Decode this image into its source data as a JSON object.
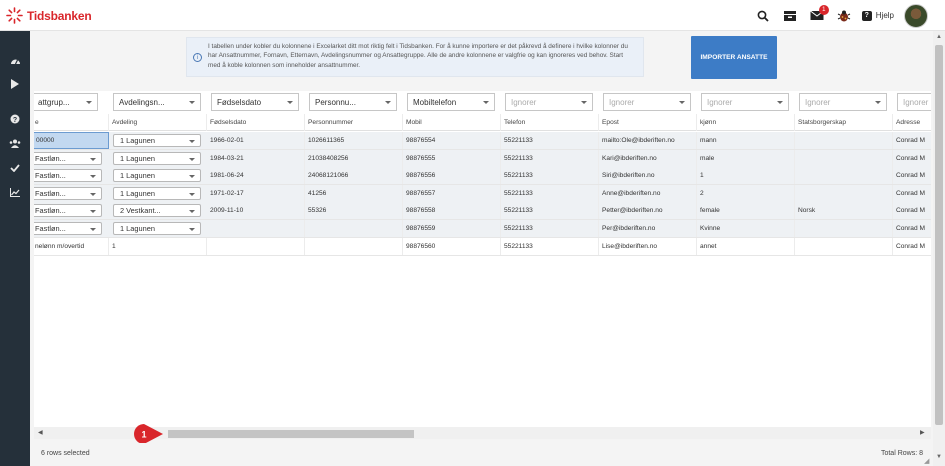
{
  "app": {
    "brand": "Tidsbanken"
  },
  "topbar": {
    "notification_count": "1",
    "help_label": "Hjelp"
  },
  "info": {
    "text": "I tabellen under kobler du kolonnene i Excelarket ditt mot riktig felt i Tidsbanken. For å kunne importere er det påkrevd å definere i hvilke kolonner du har Ansattnummer, Fornavn, Etternavn, Avdelingsnummer og Ansattegruppe. Alle de andre kolonnene er valgfrie og kan ignoreres ved behov. Start med å koble kolonnen som inneholder ansattnummer."
  },
  "import_button": "IMPORTER ANSATTE",
  "mapping_selects": [
    "attgrup...",
    "Avdelingsn...",
    "Fødselsdato",
    "Personnu...",
    "Mobiltelefon",
    "Ignorer",
    "Ignorer",
    "Ignorer",
    "Ignorer",
    "Ignorer",
    "Ignorer"
  ],
  "headers": [
    "e",
    "Avdeling",
    "Fødselsdato",
    "Personnummer",
    "Mobil",
    "Telefon",
    "Epost",
    "kjønn",
    "Statsborgerskap",
    "Adresse"
  ],
  "rows": [
    {
      "c0": "00000",
      "c1": "1 Lagunen",
      "c2": "1966-02-01",
      "c3": "1026611365",
      "c4": "98876554",
      "c5": "55221133",
      "c6": "mailto:Ole@ibderiften.no",
      "c7": "mann",
      "c8": "",
      "c9": "Conrad M"
    },
    {
      "c0": "Fastløn...",
      "c1": "1 Lagunen",
      "c2": "1984-03-21",
      "c3": "21038408256",
      "c4": "98876555",
      "c5": "55221133",
      "c6": "Kari@ibderiften.no",
      "c7": "male",
      "c8": "",
      "c9": "Conrad M"
    },
    {
      "c0": "Fastløn...",
      "c1": "1 Lagunen",
      "c2": "1981-06-24",
      "c3": "24068121066",
      "c4": "98876556",
      "c5": "55221133",
      "c6": "Siri@ibderiften.no",
      "c7": "1",
      "c8": "",
      "c9": "Conrad M"
    },
    {
      "c0": "Fastløn...",
      "c1": "1 Lagunen",
      "c2": "1971-02-17",
      "c3": "41256",
      "c4": "98876557",
      "c5": "55221133",
      "c6": "Anne@ibderiften.no",
      "c7": "2",
      "c8": "",
      "c9": "Conrad M"
    },
    {
      "c0": "Fastløn...",
      "c1": "2 Vestkant...",
      "c2": "2009-11-10",
      "c3": "55326",
      "c4": "98876558",
      "c5": "55221133",
      "c6": "Petter@ibderiften.no",
      "c7": "female",
      "c8": "Norsk",
      "c9": "Conrad M"
    },
    {
      "c0": "Fastløn...",
      "c1": "1 Lagunen",
      "c2": "",
      "c3": "",
      "c4": "98876559",
      "c5": "55221133",
      "c6": "Per@ibderiften.no",
      "c7": "Kvinne",
      "c8": "",
      "c9": "Conrad M"
    },
    {
      "c0": "nelønn m/overtid",
      "c1": "1",
      "c2": "",
      "c3": "",
      "c4": "98876560",
      "c5": "55221133",
      "c6": "Lise@ibderiften.no",
      "c7": "annet",
      "c8": "",
      "c9": "Conrad M"
    }
  ],
  "marker_label": "1",
  "footer": {
    "selected": "6 rows selected",
    "total": "Total Rows: 8"
  },
  "colors": {
    "accent": "#3d7cc6",
    "brand_red": "#d9262b",
    "sidebar": "#25303a"
  }
}
